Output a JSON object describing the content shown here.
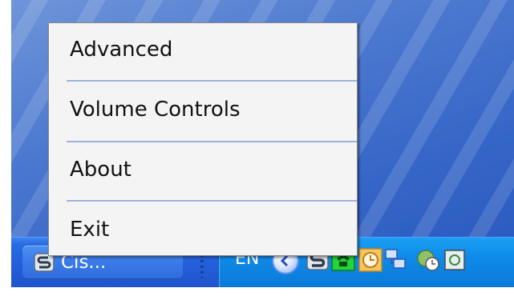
{
  "context_menu": {
    "items": [
      {
        "label": "Advanced"
      },
      {
        "label": "Volume Controls"
      },
      {
        "label": "About"
      },
      {
        "label": "Exit"
      }
    ]
  },
  "taskbar": {
    "task_button": {
      "label": "Cis...",
      "icon": "cisco-app-icon"
    },
    "tray": {
      "language": "EN",
      "icons": [
        "collapse-arrow-icon",
        "cisco-tray-icon",
        "green-phone-icon",
        "clock-icon",
        "network-icon",
        "update-icon"
      ]
    }
  },
  "colors": {
    "menu_background": "#f4f4f4",
    "menu_separator": "#9bb4dc",
    "taskbar_blue": "#245fdb",
    "tray_blue": "#0f8ae8"
  }
}
